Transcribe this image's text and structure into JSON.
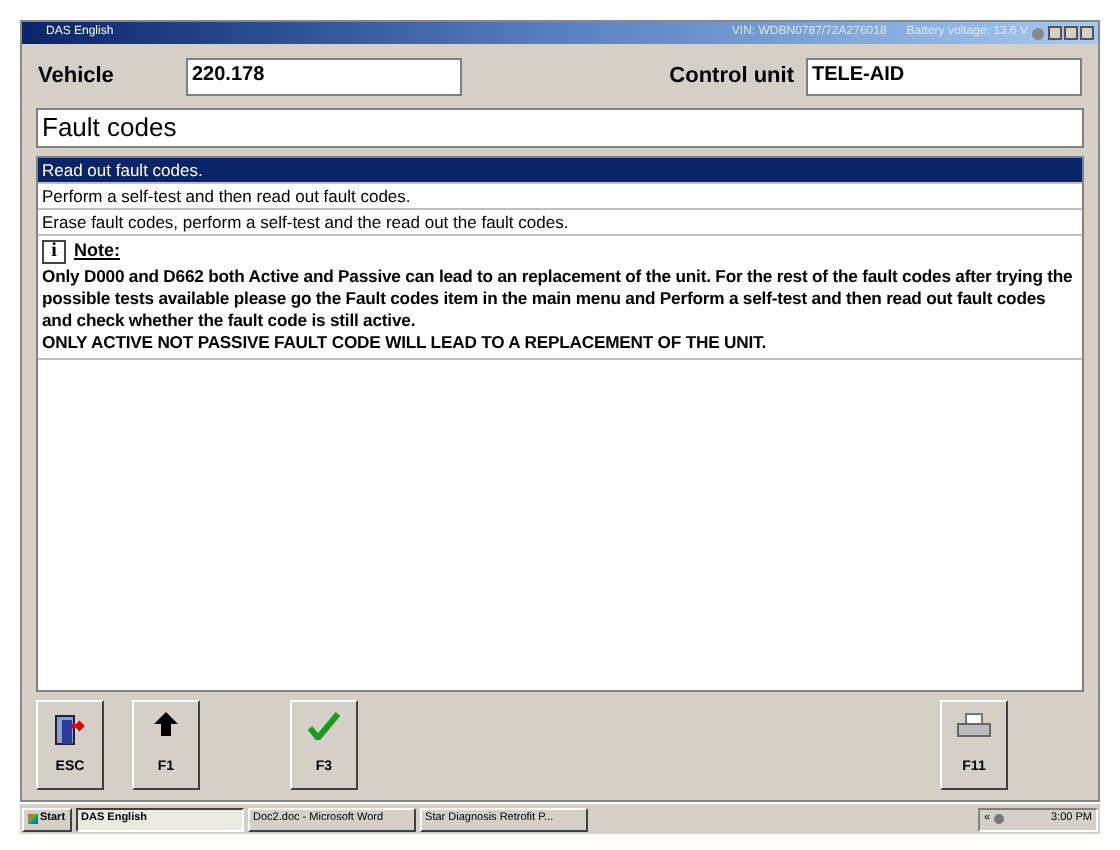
{
  "window": {
    "title": "DAS English",
    "vin": "VIN: WDBN0787/72A276018",
    "battery": "Battery voltage: 13.6  V"
  },
  "header": {
    "vehicle_label": "Vehicle",
    "vehicle_value": "220.178",
    "control_unit_label": "Control unit",
    "control_unit_value": "TELE-AID"
  },
  "section_title": "Fault codes",
  "options": [
    {
      "label": "Read out fault codes.",
      "selected": true
    },
    {
      "label": "Perform a self-test and then read out fault codes.",
      "selected": false
    },
    {
      "label": "Erase fault codes, perform a self-test and the read out the fault codes.",
      "selected": false
    }
  ],
  "note": {
    "title": "Note:",
    "icon": "i",
    "lines": [
      "Only D000 and D662 both Active and Passive can lead to an replacement of the unit. For the rest of the fault codes after trying the possible tests available please go the Fault codes item in the main menu and Perform a self-test and then read out fault codes and check whether the fault code is still active.",
      "ONLY ACTIVE NOT PASSIVE FAULT CODE WILL LEAD TO A REPLACEMENT OF THE UNIT."
    ]
  },
  "buttons": [
    {
      "kind": "exit",
      "label": "ESC"
    },
    {
      "kind": "up",
      "label": "F1"
    },
    {
      "kind": "check",
      "label": "F3"
    },
    {
      "kind": "print",
      "label": "F11"
    }
  ],
  "taskbar": {
    "start": "Start",
    "tasks": [
      {
        "label": "DAS English",
        "selected": true
      },
      {
        "label": "Doc2.doc - Microsoft Word",
        "selected": false
      },
      {
        "label": "Star Diagnosis Retrofit P...",
        "selected": false
      }
    ],
    "tray_text": "«",
    "clock": "3:00 PM"
  }
}
